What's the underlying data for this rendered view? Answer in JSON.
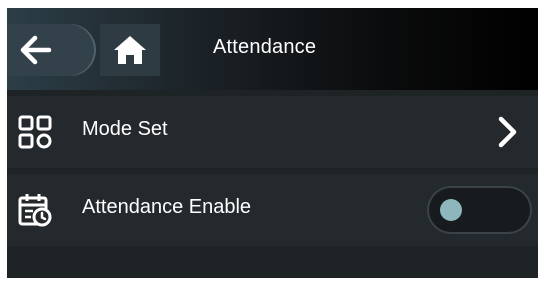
{
  "header": {
    "title": "Attendance",
    "back_icon": "arrow-left-icon",
    "home_icon": "home-icon"
  },
  "menu": {
    "items": [
      {
        "label": "Mode Set",
        "icon": "grid-icon",
        "control": "chevron-right-icon"
      },
      {
        "label": "Attendance Enable",
        "icon": "calendar-clock-icon",
        "control": "toggle",
        "enabled": false
      }
    ]
  },
  "colors": {
    "background": "#1e2326",
    "row": "#24292d",
    "text": "#ffffff",
    "toggle_knob": "#8eb6bd"
  }
}
